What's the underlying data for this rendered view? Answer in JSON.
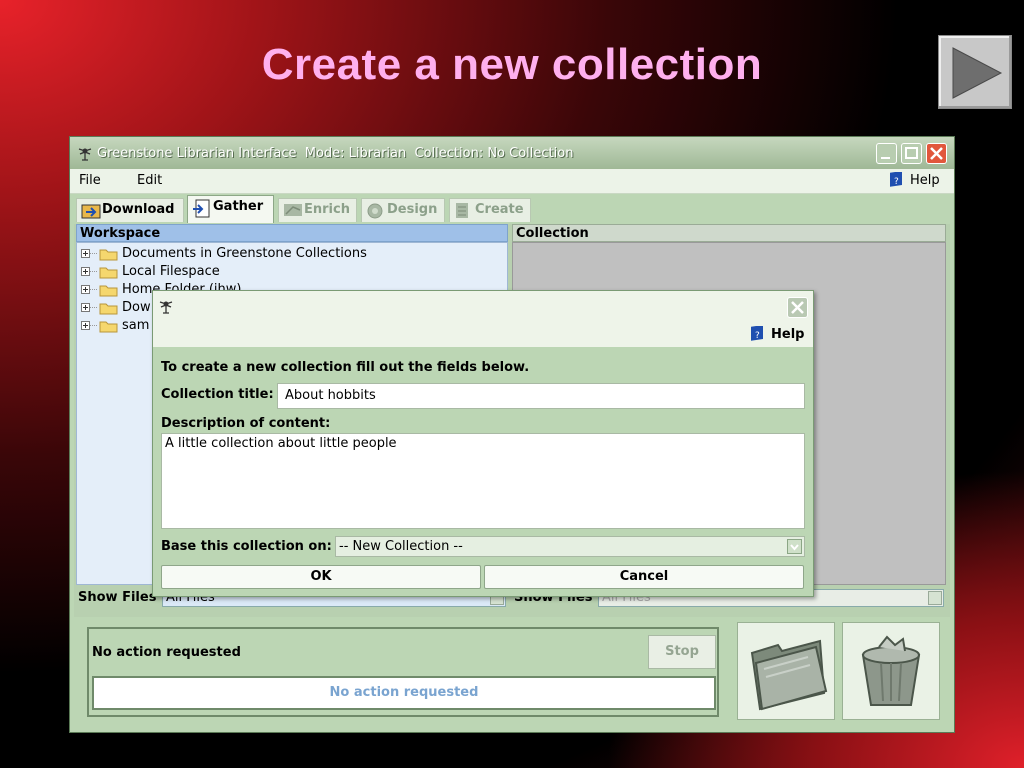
{
  "slide": {
    "title": "Create a new collection",
    "next_icon": "play-triangle-icon"
  },
  "window": {
    "title": "Greenstone Librarian Interface  Mode: Librarian  Collection: No Collection",
    "menu": {
      "file": "File",
      "edit": "Edit",
      "help": "Help"
    },
    "tabs": [
      {
        "label": "Download",
        "state": "enabled"
      },
      {
        "label": "Gather",
        "state": "active"
      },
      {
        "label": "Enrich",
        "state": "disabled"
      },
      {
        "label": "Design",
        "state": "disabled"
      },
      {
        "label": "Create",
        "state": "disabled"
      }
    ],
    "workspace": {
      "header": "Workspace",
      "items": [
        "Documents in Greenstone Collections",
        "Local Filespace",
        "Home Folder (ihw)",
        "Dow",
        "sam"
      ]
    },
    "collection": {
      "header": "Collection"
    },
    "show_files_left": {
      "label": "Show Files",
      "value": "All Files"
    },
    "show_files_right": {
      "label": "Show Files",
      "value": "All Files"
    },
    "status": {
      "label": "No action requested",
      "stop": "Stop",
      "progress_text": "No action requested"
    }
  },
  "dialog": {
    "help": "Help",
    "intro": "To create a new collection fill out the fields below.",
    "title_label": "Collection title:",
    "title_value": "About hobbits",
    "desc_label": "Description of content:",
    "desc_value": "A little collection about little people",
    "base_label": "Base this collection on:",
    "base_value": "-- New Collection --",
    "ok": "OK",
    "cancel": "Cancel"
  },
  "colors": {
    "title_pink": "#ffb0ee",
    "window_green": "#bcd6b4",
    "workspace_blue": "#9fc0e8"
  }
}
